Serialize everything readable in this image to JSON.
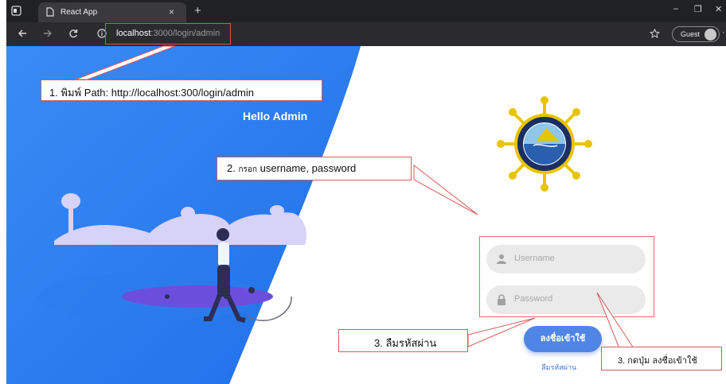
{
  "browser": {
    "tab_title": "React App",
    "tab_close": "×",
    "new_tab": "+",
    "url_host": "localhost",
    "url_path": ":3000/login/admin",
    "guest_label": "Guest",
    "more": "···",
    "minimize": "–",
    "restore": "❐",
    "close": "✕"
  },
  "page": {
    "greeting": "Hello Admin",
    "username_placeholder": "Username",
    "password_placeholder": "Password",
    "login_button": "ลงชื่อเข้าใช้",
    "forgot_password": "ลืมรหัสผ่าน"
  },
  "annotations": {
    "step1": "1. พิมพ์ Path: http://localhost:300/login/admin",
    "step2_num": "2.",
    "step2_small": "กรอก",
    "step2_text": "username, password",
    "step3_forgot": "3. ลืมรหัสผ่าน",
    "step3_login": "3. กดปุ่ม ลงชื่อเข้าใช้"
  },
  "colors": {
    "accent": "#4f86e6",
    "wave_blue": "#2f7bf2",
    "callout_border": "#d85a5a"
  }
}
